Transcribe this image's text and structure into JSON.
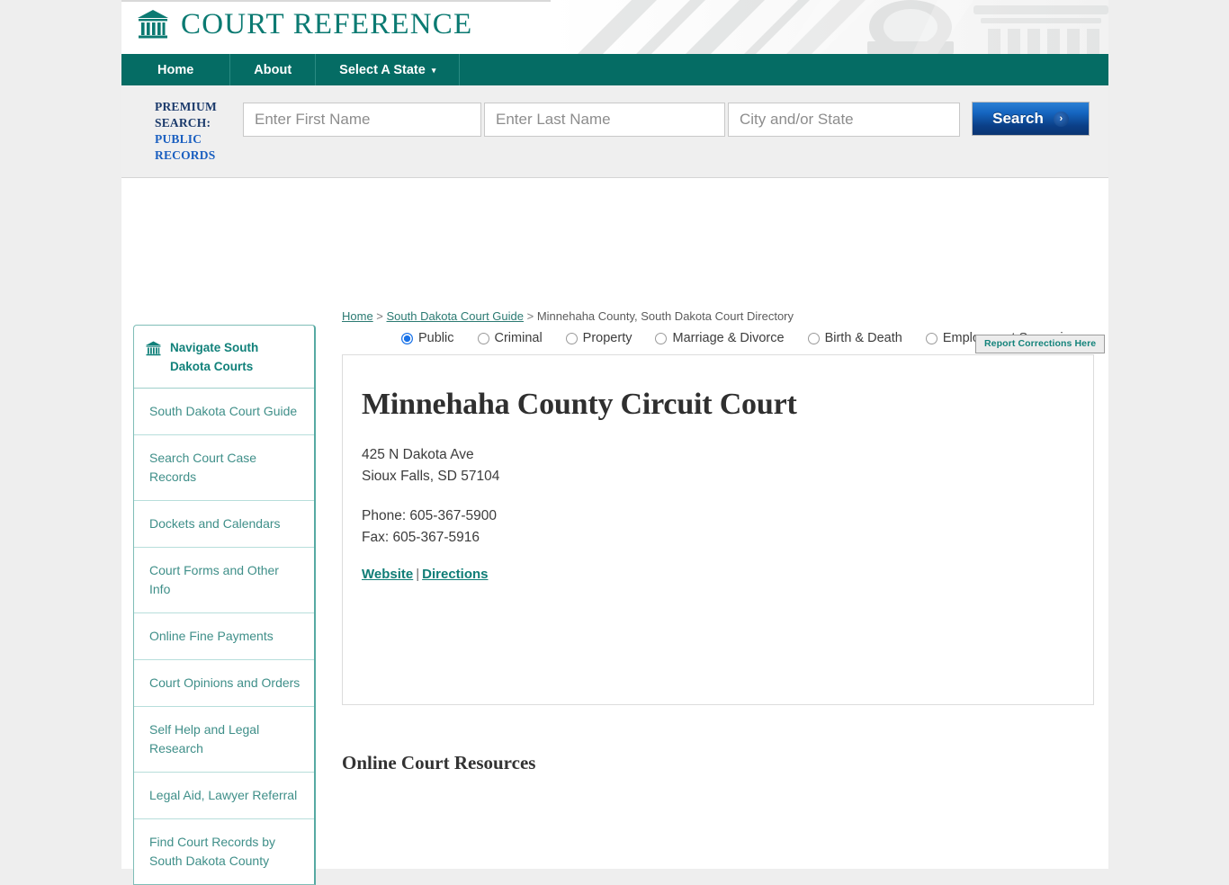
{
  "site": {
    "brand": "COURT REFERENCE",
    "brand_icon": "courthouse-icon"
  },
  "nav": {
    "items": [
      {
        "label": "Home"
      },
      {
        "label": "About"
      },
      {
        "label": "Select A State",
        "caret": "▾"
      }
    ]
  },
  "premium_search": {
    "label_line1": "PREMIUM",
    "label_line2": "SEARCH:",
    "label_line3": "PUBLIC",
    "label_line4": "RECORDS",
    "first_name_placeholder": "Enter First Name",
    "first_name_value": "",
    "last_name_placeholder": "Enter Last Name",
    "last_name_value": "",
    "city_state_placeholder": "City and/or State",
    "city_state_value": "",
    "search_button": "Search",
    "search_chevron": "›",
    "record_types": [
      {
        "label": "Public",
        "selected": true
      },
      {
        "label": "Criminal",
        "selected": false
      },
      {
        "label": "Property",
        "selected": false
      },
      {
        "label": "Marriage & Divorce",
        "selected": false
      },
      {
        "label": "Birth & Death",
        "selected": false
      },
      {
        "label": "Employment Screening",
        "selected": false
      }
    ]
  },
  "breadcrumb": {
    "home": "Home",
    "sep1": " > ",
    "guide": "South Dakota Court Guide",
    "sep2": " > ",
    "current": "Minnehaha County, South Dakota Court Directory"
  },
  "report_corrections": "Report Corrections Here",
  "sidebar": {
    "heading": "Navigate South Dakota Courts",
    "heading_icon": "courthouse-icon",
    "items": [
      {
        "label": "South Dakota Court Guide"
      },
      {
        "label": "Search Court Case Records"
      },
      {
        "label": "Dockets and Calendars"
      },
      {
        "label": "Court Forms and Other Info"
      },
      {
        "label": "Online Fine Payments"
      },
      {
        "label": "Court Opinions and Orders"
      },
      {
        "label": "Self Help and Legal Research"
      },
      {
        "label": "Legal Aid, Lawyer Referral"
      },
      {
        "label": "Find Court Records by South Dakota County"
      }
    ]
  },
  "court": {
    "title": "Minnehaha County Circuit Court",
    "address_line1": "425 N Dakota Ave",
    "address_line2": "Sioux Falls, SD 57104",
    "phone": "Phone: 605-367-5900",
    "fax": "Fax: 605-367-5916",
    "website_link": "Website",
    "link_separator": "|",
    "directions_link": "Directions"
  },
  "sections": {
    "online_resources": "Online Court Resources"
  },
  "colors": {
    "teal": "#056c64",
    "brand_teal": "#0b7a72",
    "link_teal": "#0f7d76",
    "search_blue": "#1565c0",
    "page_bg": "#eeeeee",
    "strip_bg": "#efefef"
  }
}
